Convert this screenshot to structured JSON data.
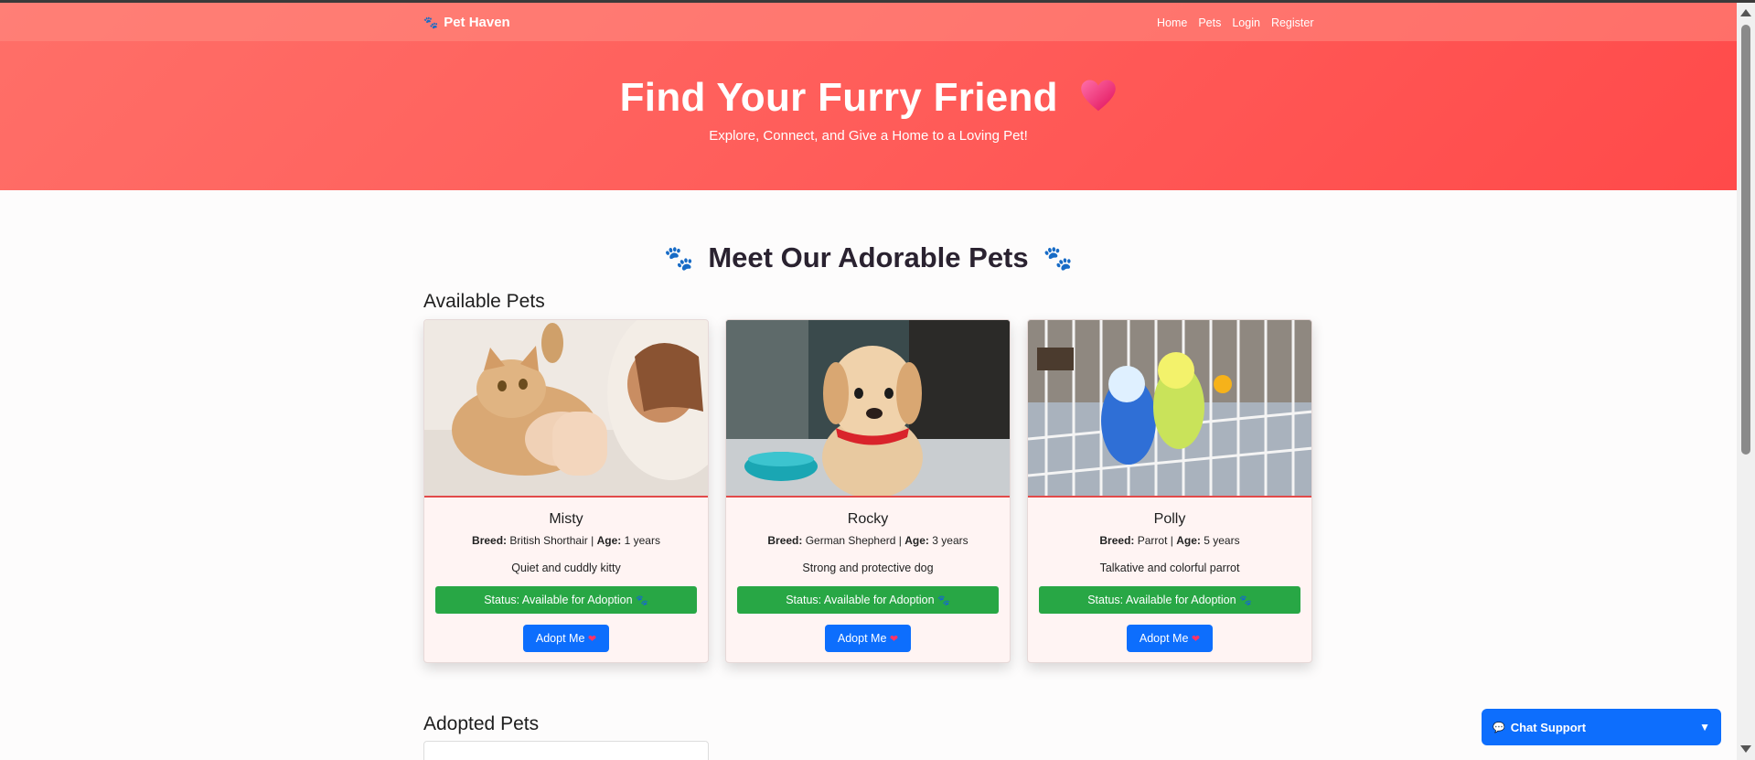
{
  "nav": {
    "brand": "Pet Haven",
    "links": [
      "Home",
      "Pets",
      "Login",
      "Register"
    ]
  },
  "hero": {
    "title": "Find Your Furry Friend",
    "subtitle": "Explore, Connect, and Give a Home to a Loving Pet!"
  },
  "section_title": "Meet Our Adorable Pets",
  "available_heading": "Available Pets",
  "adopted_heading": "Adopted Pets",
  "labels": {
    "breed": "Breed:",
    "age": "Age:"
  },
  "pets": [
    {
      "name": "Misty",
      "breed": "British Shorthair",
      "age": "1 years",
      "description": "Quiet and cuddly kitty",
      "status": "Status: Available for Adoption",
      "button": "Adopt Me"
    },
    {
      "name": "Rocky",
      "breed": "German Shepherd",
      "age": "3 years",
      "description": "Strong and protective dog",
      "status": "Status: Available for Adoption",
      "button": "Adopt Me"
    },
    {
      "name": "Polly",
      "breed": "Parrot",
      "age": "5 years",
      "description": "Talkative and colorful parrot",
      "status": "Status: Available for Adoption",
      "button": "Adopt Me"
    }
  ],
  "chat": {
    "label": "Chat Support",
    "toggle": "▼"
  },
  "colors": {
    "hero": "#ff5a58",
    "status": "#28a745",
    "primary": "#0d6efd"
  }
}
